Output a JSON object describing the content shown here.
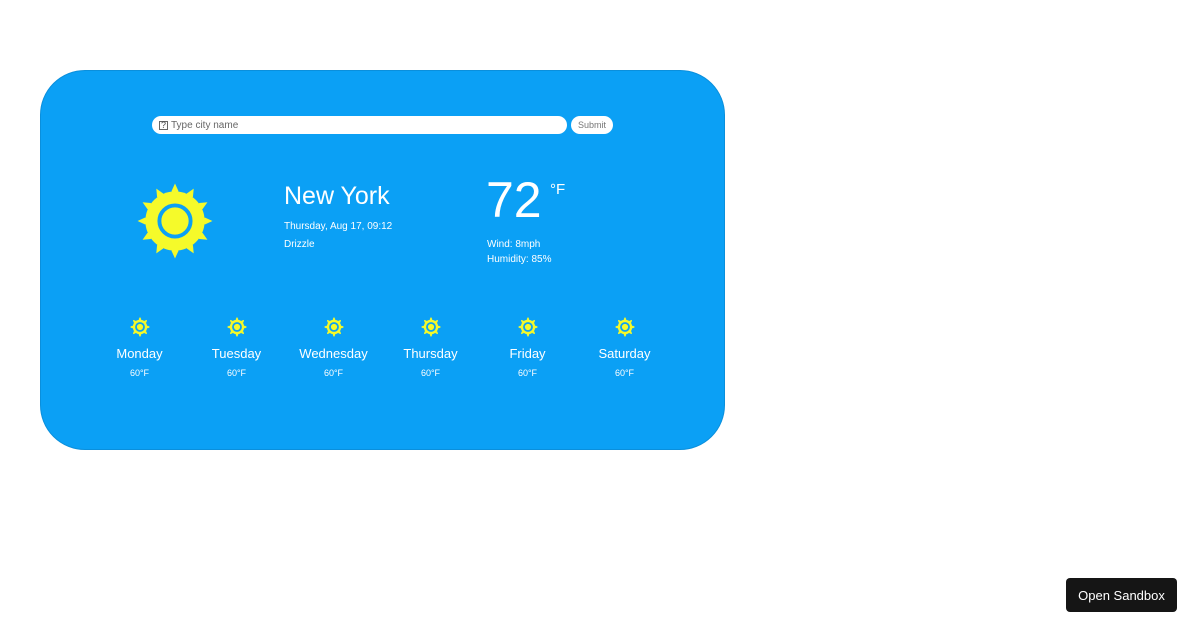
{
  "search": {
    "icon": "search-icon",
    "glyph": "?",
    "placeholder": "Type city name",
    "submit_label": "Submit"
  },
  "current": {
    "icon": "sun-icon",
    "city": "New York",
    "datetime": "Thursday, Aug 17, 09:12",
    "description": "Drizzle",
    "temperature": "72",
    "unit": "°F",
    "wind": "Wind: 8mph",
    "humidity": "Humidity: 85%"
  },
  "forecast": [
    {
      "day": "Monday",
      "temp": "60°F",
      "icon": "sun-icon"
    },
    {
      "day": "Tuesday",
      "temp": "60°F",
      "icon": "sun-icon"
    },
    {
      "day": "Wednesday",
      "temp": "60°F",
      "icon": "sun-icon"
    },
    {
      "day": "Thursday",
      "temp": "60°F",
      "icon": "sun-icon"
    },
    {
      "day": "Friday",
      "temp": "60°F",
      "icon": "sun-icon"
    },
    {
      "day": "Saturday",
      "temp": "60°F",
      "icon": "sun-icon"
    }
  ],
  "open_sandbox_label": "Open Sandbox",
  "colors": {
    "card_background": "#0ba0f5",
    "sun_fill": "#f5fa2a",
    "sandbox_button": "#151515"
  }
}
